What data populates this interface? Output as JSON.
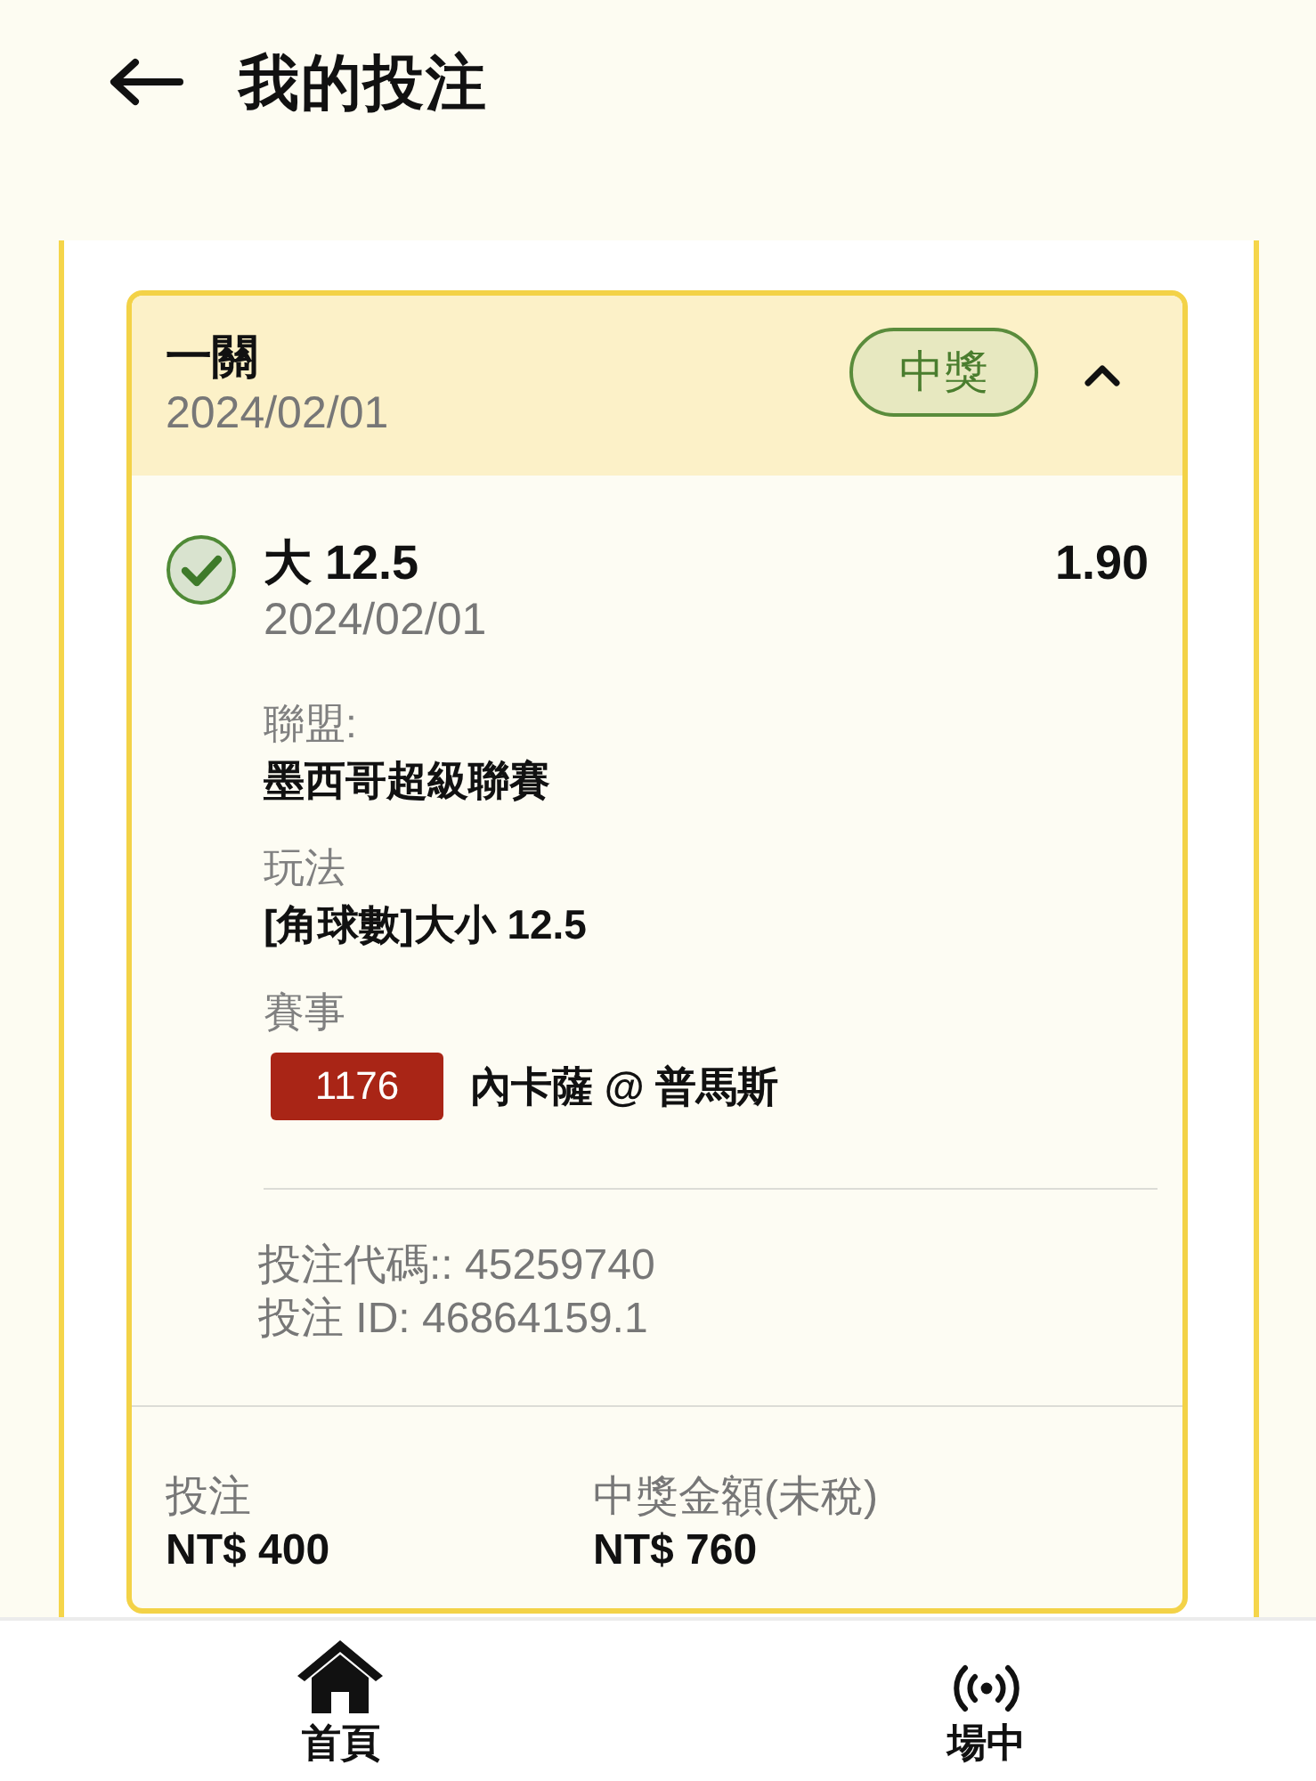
{
  "header": {
    "title": "我的投注"
  },
  "bet_card": {
    "type": "一關",
    "date": "2024/02/01",
    "status": {
      "label": "中獎"
    },
    "expanded": true,
    "selections": [
      {
        "won": true,
        "pick": "大 12.5",
        "odds": "1.90",
        "date": "2024/02/01",
        "details": [
          {
            "kind": "text",
            "label": "聯盟:",
            "value": "墨西哥超級聯賽"
          },
          {
            "kind": "text",
            "label": "玩法",
            "value": "[角球數]大小 12.5"
          },
          {
            "kind": "match",
            "label": "賽事",
            "match_number": "1176",
            "value": "內卡薩 @ 普馬斯"
          }
        ],
        "codes": [
          "投注代碼:: 45259740",
          "投注 ID: 46864159.1"
        ]
      }
    ],
    "totals": [
      {
        "label": "投注",
        "value": "NT$ 400"
      },
      {
        "label": "中獎金額(未稅)",
        "value": "NT$ 760"
      }
    ]
  },
  "bottom_nav": [
    {
      "label": "首頁"
    },
    {
      "label": "場中"
    }
  ]
}
